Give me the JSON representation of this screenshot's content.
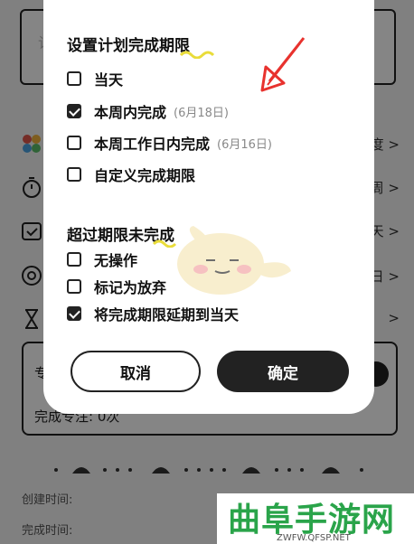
{
  "background": {
    "input_placeholder": "记",
    "rows": [
      {
        "icon": "palette-icon",
        "value": "度 >"
      },
      {
        "icon": "timer-icon",
        "value": "周 >"
      },
      {
        "icon": "calendar-check-icon",
        "value": "天 >"
      },
      {
        "icon": "target-icon",
        "value": "日 >"
      },
      {
        "icon": "hourglass-icon",
        "value": ">"
      }
    ],
    "card": {
      "label_top": "专",
      "label_bottom": "完成专注: 0次"
    },
    "created_label": "创建时间:",
    "completed_label": "完成时间:"
  },
  "dialog": {
    "section1_title": "设置计划完成期限",
    "section1_options": [
      {
        "label": "当天",
        "hint": "",
        "checked": false
      },
      {
        "label": "本周内完成",
        "hint": "(6月18日)",
        "checked": true
      },
      {
        "label": "本周工作日内完成",
        "hint": "(6月16日)",
        "checked": false
      },
      {
        "label": "自定义完成期限",
        "hint": "",
        "checked": false
      }
    ],
    "section2_title": "超过期限未完成",
    "section2_options": [
      {
        "label": "无操作",
        "checked": false
      },
      {
        "label": "标记为放弃",
        "checked": false
      },
      {
        "label": "将完成期限延期到当天",
        "checked": true
      }
    ],
    "cancel_label": "取消",
    "confirm_label": "确定"
  },
  "annotation": {
    "arrow_color": "#e8322e"
  },
  "watermark": {
    "title": "曲阜手游网",
    "url": "ZWFW.QFSP.NET",
    "color": "#2aa44a"
  }
}
